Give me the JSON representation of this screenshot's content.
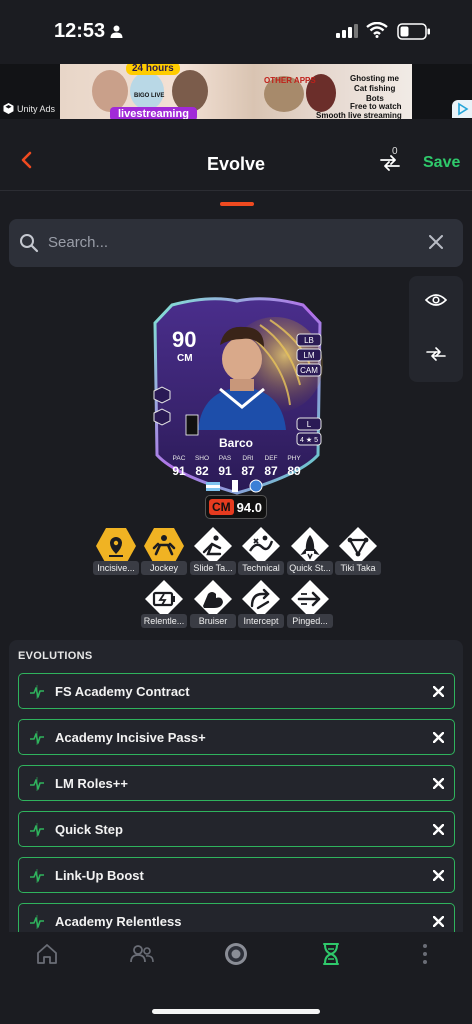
{
  "status_bar": {
    "time": "12:53"
  },
  "ad": {
    "network_label": "Unity Ads",
    "texts": [
      "24 hours",
      "BIGO LIVE",
      "livestreaming",
      "OTHER APPS",
      "Ghosting me",
      "Cat fishing",
      "Bots",
      "Free to watch",
      "Smooth live streaming"
    ]
  },
  "header": {
    "title": "Evolve",
    "compare_count": "0",
    "save_label": "Save"
  },
  "search": {
    "placeholder": "Search..."
  },
  "player": {
    "rating": "90",
    "position": "CM",
    "alt_positions": [
      "LB",
      "LM",
      "CAM"
    ],
    "foot": "L",
    "skills_weakfoot": "4 ★ 5",
    "name": "Barco",
    "stat_labels": [
      "PAC",
      "SHO",
      "PAS",
      "DRI",
      "DEF",
      "PHY"
    ],
    "stat_values": [
      "91",
      "82",
      "91",
      "87",
      "87",
      "89"
    ],
    "position_rating_label": "CM",
    "position_rating_value": "94.0"
  },
  "playstyles": [
    {
      "label": "Incisive...",
      "plus": true
    },
    {
      "label": "Jockey",
      "plus": true
    },
    {
      "label": "Slide Ta...",
      "plus": false
    },
    {
      "label": "Technical",
      "plus": false
    },
    {
      "label": "Quick St...",
      "plus": false
    },
    {
      "label": "Tiki Taka",
      "plus": false
    },
    {
      "label": "Relentle...",
      "plus": false
    },
    {
      "label": "Bruiser",
      "plus": false
    },
    {
      "label": "Intercept",
      "plus": false
    },
    {
      "label": "Pinged...",
      "plus": false
    }
  ],
  "evolutions": {
    "title": "EVOLUTIONS",
    "items": [
      {
        "label": "FS Academy Contract"
      },
      {
        "label": "Academy Incisive Pass+"
      },
      {
        "label": "LM Roles++"
      },
      {
        "label": "Quick Step"
      },
      {
        "label": "Link-Up Boost"
      },
      {
        "label": "Academy Relentless"
      }
    ]
  },
  "colors": {
    "accent": "#ef4a20",
    "save": "#2fc96b",
    "evo_border": "#2fb35d",
    "plus_gold": "#f0b323"
  }
}
